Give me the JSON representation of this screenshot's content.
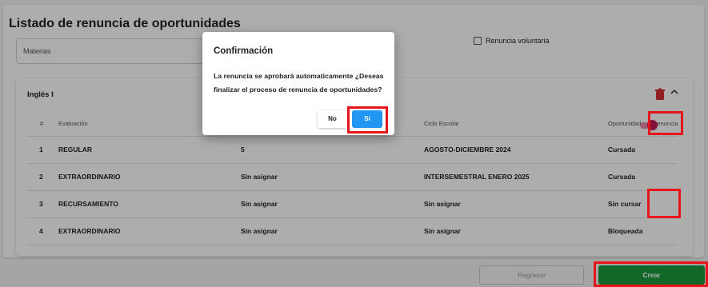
{
  "page": {
    "title": "Listado de renuncia de oportunidades"
  },
  "filters": {
    "materias_label": "Materias",
    "renuncia_voluntaria_label": "Renuncia voluntaria",
    "renuncia_voluntaria_checked": false
  },
  "course": {
    "name": "Inglés I",
    "headers": {
      "num": "#",
      "evaluacion": "Evaluación",
      "ciclo": "Ciclo Escolar",
      "oportunidad": "Oportunidad",
      "renuncia": "Renuncia"
    },
    "rows": [
      {
        "num": "1",
        "evaluacion": "REGULAR",
        "col3": "5",
        "ciclo": "AGOSTO-DICIEMBRE 2024",
        "oportunidad": "Cursada"
      },
      {
        "num": "2",
        "evaluacion": "EXTRAORDINARIO",
        "col3": "Sin asignar",
        "ciclo": "INTERSEMESTRAL ENERO 2025",
        "oportunidad": "Cursada"
      },
      {
        "num": "3",
        "evaluacion": "RECURSAMIENTO",
        "col3": "Sin asignar",
        "ciclo": "Sin asignar",
        "oportunidad": "Sin cursar",
        "renuncia_toggle": true
      },
      {
        "num": "4",
        "evaluacion": "EXTRAORDINARIO",
        "col3": "Sin asignar",
        "ciclo": "Sin asignar",
        "oportunidad": "Bloqueada"
      }
    ]
  },
  "footer": {
    "regresar_label": "Regresar",
    "crear_label": "Crear"
  },
  "modal": {
    "title": "Confirmación",
    "message": "La renuncia se aprobará automaticamente ¿Deseas finalizar el proceso de renuncia de oportunidades?",
    "no_label": "No",
    "si_label": "Sí"
  },
  "colors": {
    "primary_blue": "#2196f3",
    "crear_green": "#1b9a3c",
    "toggle_pink": "#c2185b",
    "highlight_red": "#e8141c",
    "trash_red": "#d32f2f"
  },
  "icons": {
    "delete": "trash-icon",
    "collapse": "chevron-up-icon"
  }
}
